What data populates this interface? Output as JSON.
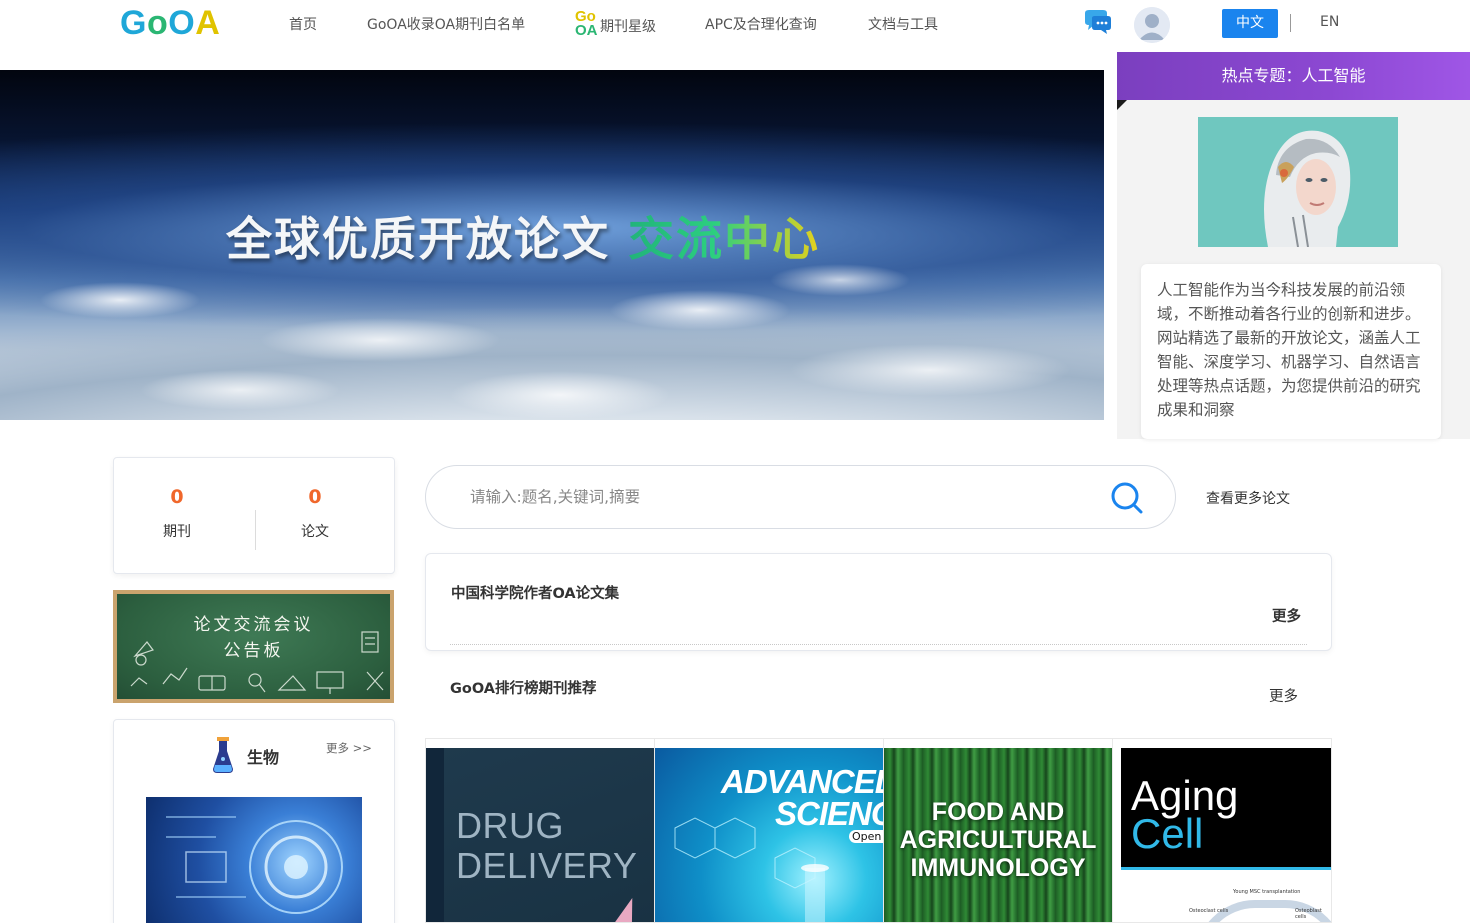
{
  "header": {
    "logo": {
      "g": "G",
      "o1": "o",
      "o2": "O",
      "a": "A"
    },
    "nav": {
      "home": "首页",
      "whitelist": "GoOA收录OA期刊白名单",
      "rating_badge_top": "Go",
      "rating_badge_bottom": "OA",
      "rating": "期刊星级",
      "apc": "APC及合理化查询",
      "docs": "文档与工具"
    },
    "lang_zh": "中文",
    "lang_en": "EN"
  },
  "banner": {
    "title_part1": "全球优质开放论文",
    "title_part2": "交流中心"
  },
  "hot_topic": {
    "title": "热点专题：人工智能",
    "description": "人工智能作为当今科技发展的前沿领域，不断推动着各行业的创新和进步。网站精选了最新的开放论文，涵盖人工智能、深度学习、机器学习、自然语言处理等热点话题，为您提供前沿的研究成果和洞察"
  },
  "stats": {
    "journals_count": "0",
    "journals_label": "期刊",
    "papers_count": "0",
    "papers_label": "论文"
  },
  "bulletin": {
    "line1": "论文交流会议",
    "line2": "公告板"
  },
  "category": {
    "title": "生物",
    "more": "更多 >>"
  },
  "search": {
    "placeholder": "请输入:题名,关键词,摘要",
    "more_papers": "查看更多论文"
  },
  "cas_section": {
    "title": "中国科学院作者OA论文集",
    "more": "更多"
  },
  "ranking_section": {
    "title": "GoOA排行榜期刊推荐",
    "more": "更多"
  },
  "journals": [
    {
      "line1": "DRUG",
      "line2": "DELIVERY"
    },
    {
      "line1": "ADVANCED",
      "line2": "SCIENCE",
      "badge": "Open"
    },
    {
      "line1": "FOOD AND",
      "line2": "AGRICULTURAL",
      "line3": "IMMUNOLOGY"
    },
    {
      "line1": "Aging",
      "line2": "Cell",
      "caption": "Young MSC transplantation",
      "label_left": "Osteoclast cells",
      "label_right": "Osteoblast cells"
    }
  ],
  "colors": {
    "brand_blue": "#1a84ee",
    "accent_orange": "#f0672b",
    "hot_purple": "#8c48d2",
    "logo_blue": "#1fa7d8",
    "logo_green": "#2bb673",
    "logo_yellow": "#e0c300"
  }
}
